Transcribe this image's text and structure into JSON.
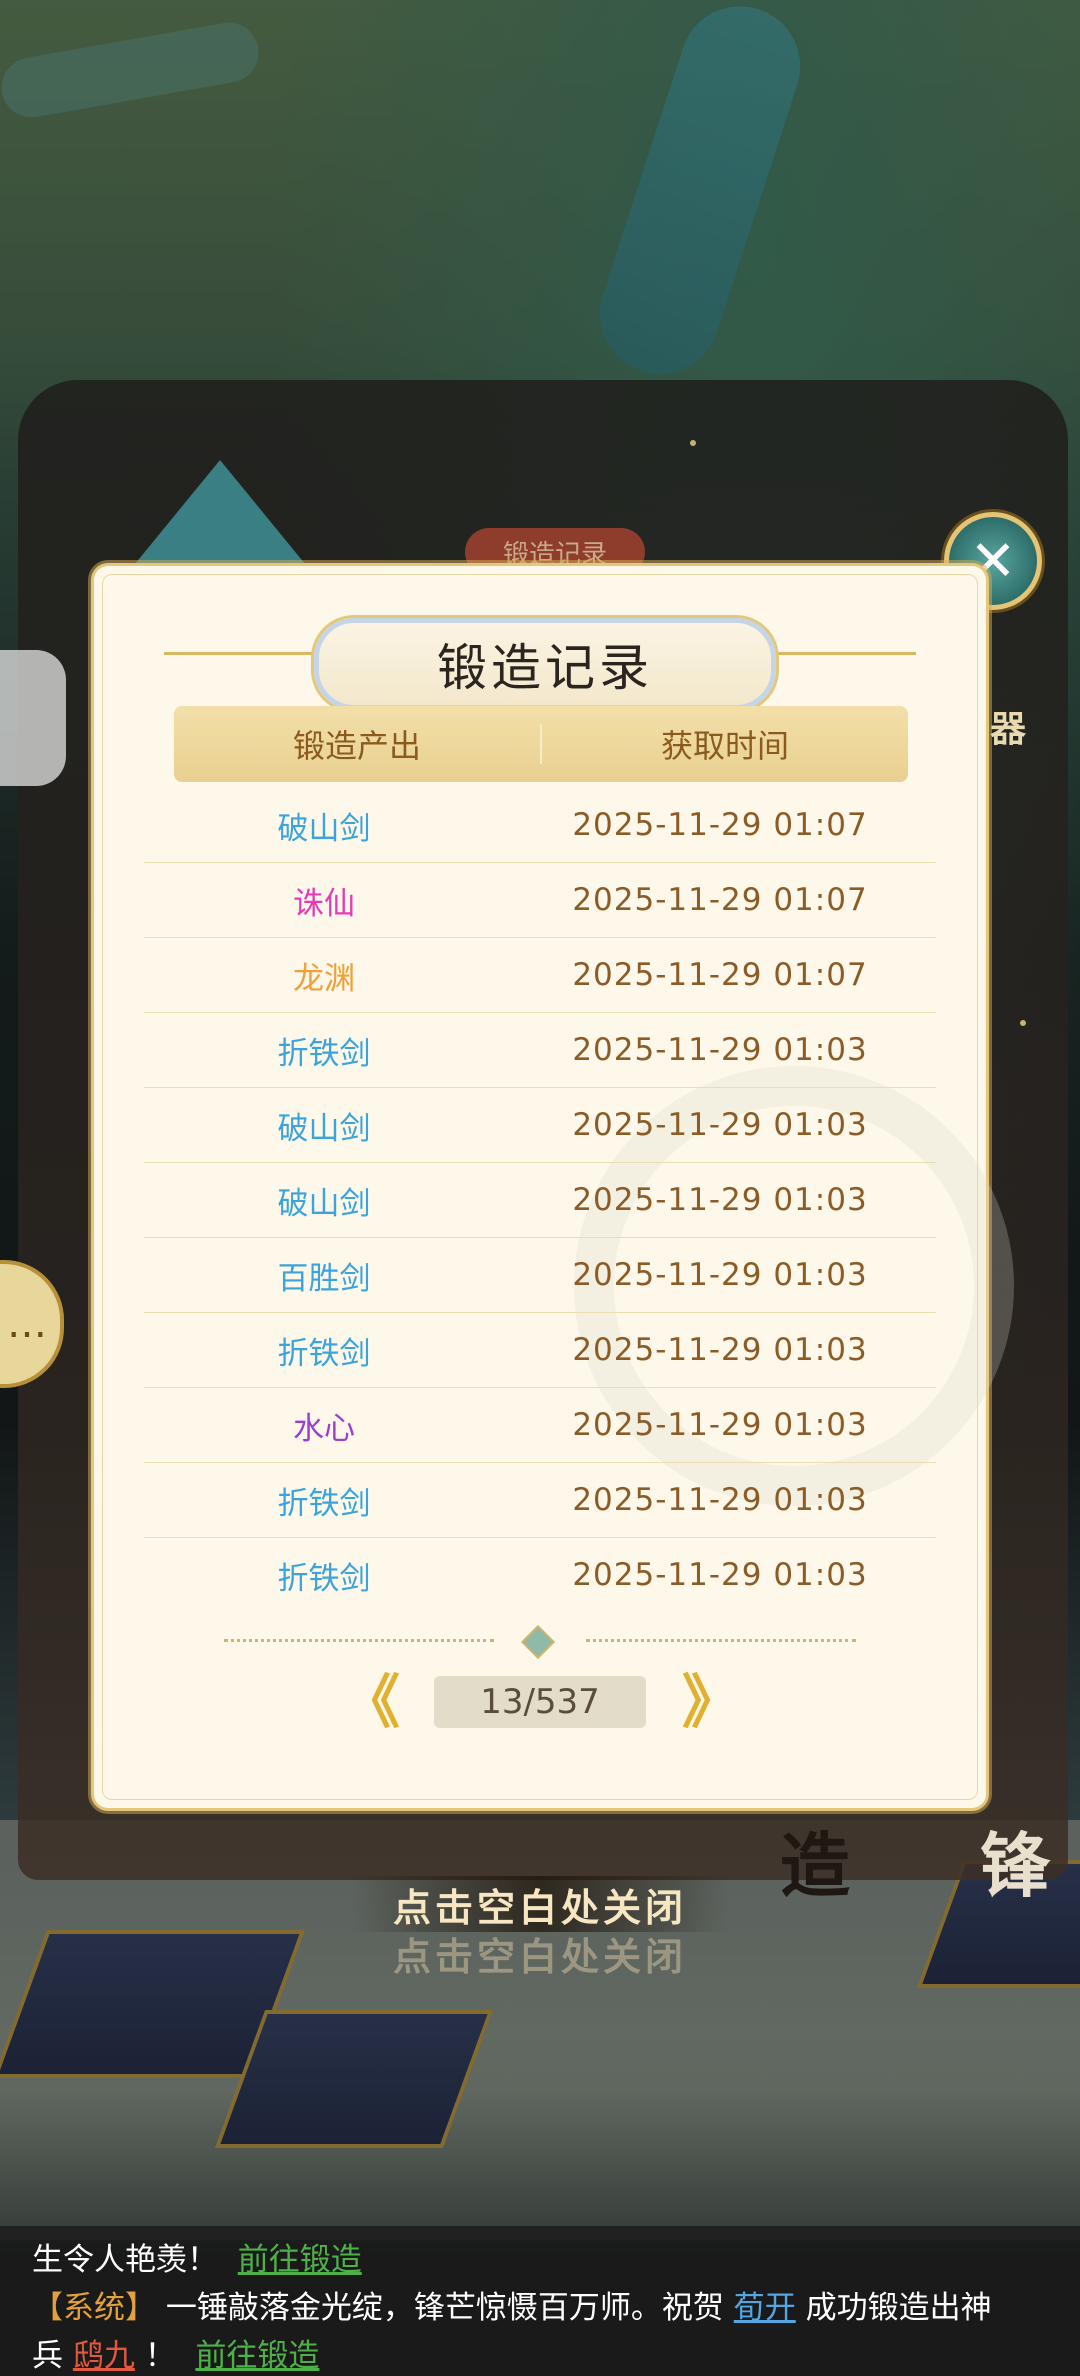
{
  "background": {
    "panel_tab": "锻造记录",
    "side_char_left": "器",
    "bottom_chars": [
      "造",
      "锋"
    ]
  },
  "modal": {
    "title": "锻造记录",
    "headers": {
      "output": "锻造产出",
      "time": "获取时间"
    },
    "rows": [
      {
        "item": "破山剑",
        "color": "#3ba4dc",
        "time": "2025-11-29  01:07"
      },
      {
        "item": "诛仙",
        "color": "#e43bb8",
        "time": "2025-11-29  01:07"
      },
      {
        "item": "龙渊",
        "color": "#f0a03a",
        "time": "2025-11-29  01:07"
      },
      {
        "item": "折铁剑",
        "color": "#3ba4dc",
        "time": "2025-11-29  01:03"
      },
      {
        "item": "破山剑",
        "color": "#3ba4dc",
        "time": "2025-11-29  01:03"
      },
      {
        "item": "破山剑",
        "color": "#3ba4dc",
        "time": "2025-11-29  01:03"
      },
      {
        "item": "百胜剑",
        "color": "#3ba4dc",
        "time": "2025-11-29  01:03"
      },
      {
        "item": "折铁剑",
        "color": "#3ba4dc",
        "time": "2025-11-29  01:03"
      },
      {
        "item": "水心",
        "color": "#9b3fd1",
        "time": "2025-11-29  01:03"
      },
      {
        "item": "折铁剑",
        "color": "#3ba4dc",
        "time": "2025-11-29  01:03"
      },
      {
        "item": "折铁剑",
        "color": "#3ba4dc",
        "time": "2025-11-29  01:03"
      }
    ],
    "pager": {
      "text": "13/537",
      "prev_glyph": "《",
      "next_glyph": "》"
    },
    "close_glyph": "✕"
  },
  "tap_hint": "点击空白处关闭",
  "chat": {
    "line1": {
      "text": "生令人艳羡！",
      "link": "前往锻造"
    },
    "line2": {
      "tag": "【系统】",
      "text": "一锤敲落金光绽，锋芒惊慑百万师。祝贺",
      "player": "荀开",
      "text2": "成功锻造出神"
    },
    "line3": {
      "prefix": "兵",
      "item": "鸱九",
      "mark": "！",
      "link": "前往锻造"
    }
  },
  "colors": {
    "accent_gold": "#e0b030",
    "item_blue": "#3ba4dc",
    "item_pink": "#e43bb8",
    "item_orange": "#f0a03a",
    "item_purple": "#9b3fd1",
    "time_brown": "#8b5c28"
  }
}
